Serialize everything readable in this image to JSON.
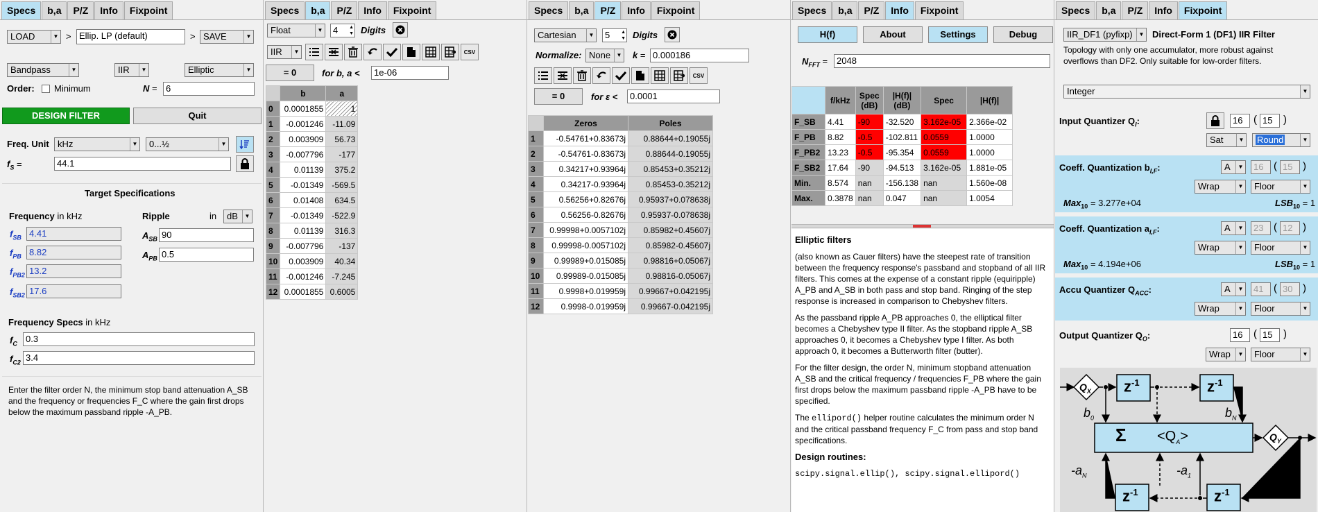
{
  "tabs": {
    "specs": "Specs",
    "ba": "b,a",
    "pz": "P/Z",
    "info": "Info",
    "fixpoint": "Fixpoint"
  },
  "panel1": {
    "load": "LOAD",
    "gt1": ">",
    "preset": "Ellip. LP (default)",
    "gt2": ">",
    "save": "SAVE",
    "response_type": "Bandpass",
    "filter_class": "IIR",
    "design_method": "Elliptic",
    "order_label": "Order:",
    "minimum_label": "Minimum",
    "n_label": "N",
    "n_eq": "=",
    "n_value": "6",
    "design_button": "DESIGN FILTER",
    "quit_button": "Quit",
    "freq_unit_label": "Freq. Unit",
    "freq_unit": "kHz",
    "freq_range": "0...½",
    "fs_label": "f",
    "fs_sub": "S",
    "fs_eq": "=",
    "fs_value": "44.1",
    "target_title": "Target Specifications",
    "frequency_label": "Frequency",
    "in_khz": "in kHz",
    "ripple_label": "Ripple",
    "in_label": "in",
    "ripple_unit": "dB",
    "freqs": [
      {
        "label": "f",
        "sub": "SB",
        "value": "4.41"
      },
      {
        "label": "f",
        "sub": "PB",
        "value": "8.82"
      },
      {
        "label": "f",
        "sub": "PB2",
        "value": "13.2"
      },
      {
        "label": "f",
        "sub": "SB2",
        "value": "17.6"
      }
    ],
    "asb_label": "A",
    "asb_sub": "SB",
    "asb_value": "90",
    "apb_label": "A",
    "apb_sub": "PB",
    "apb_value": "0.5",
    "freq_specs_title": "Frequency Specs",
    "freq_specs_unit": "in kHz",
    "fc_label": "f",
    "fc_sub": "C",
    "fc_value": "0.3",
    "fc2_label": "f",
    "fc2_sub": "C2",
    "fc2_value": "3.4",
    "help_text": "Enter the filter order N, the minimum stop band attenuation A_SB and the frequency or frequencies F_C where the gain first drops below the maximum passband ripple -A_PB."
  },
  "panel2": {
    "format": "Float",
    "digits_value": "4",
    "digits_label": "Digits",
    "filter_type": "IIR",
    "eq_zero": "= 0",
    "for_ba": "for b, a <",
    "eps_value": "1e-06",
    "columns": [
      "b",
      "a"
    ],
    "rows": [
      [
        "0",
        "0.0001855",
        "1"
      ],
      [
        "1",
        "-0.001246",
        "-11.09"
      ],
      [
        "2",
        "0.003909",
        "56.73"
      ],
      [
        "3",
        "-0.007796",
        "-177"
      ],
      [
        "4",
        "0.01139",
        "375.2"
      ],
      [
        "5",
        "-0.01349",
        "-569.5"
      ],
      [
        "6",
        "0.01408",
        "634.5"
      ],
      [
        "7",
        "-0.01349",
        "-522.9"
      ],
      [
        "8",
        "0.01139",
        "316.3"
      ],
      [
        "9",
        "-0.007796",
        "-137"
      ],
      [
        "10",
        "0.003909",
        "40.34"
      ],
      [
        "11",
        "-0.001246",
        "-7.245"
      ],
      [
        "12",
        "0.0001855",
        "0.6005"
      ]
    ]
  },
  "panel3": {
    "coord": "Cartesian",
    "digits_value": "5",
    "digits_label": "Digits",
    "normalize_label": "Normalize:",
    "normalize": "None",
    "k_label": "k",
    "k_eq": "=",
    "k_value": "0.000186",
    "eq_zero": "= 0",
    "for_eps": "for ε <",
    "eps_value": "0.0001",
    "columns": [
      "Zeros",
      "Poles"
    ],
    "rows": [
      [
        "1",
        "-0.54761+0.83673j",
        "0.88644+0.19055j"
      ],
      [
        "2",
        "-0.54761-0.83673j",
        "0.88644-0.19055j"
      ],
      [
        "3",
        "0.34217+0.93964j",
        "0.85453+0.35212j"
      ],
      [
        "4",
        "0.34217-0.93964j",
        "0.85453-0.35212j"
      ],
      [
        "5",
        "0.56256+0.82676j",
        "0.95937+0.078638j"
      ],
      [
        "6",
        "0.56256-0.82676j",
        "0.95937-0.078638j"
      ],
      [
        "7",
        "0.99998+0.0057102j",
        "0.85982+0.45607j"
      ],
      [
        "8",
        "0.99998-0.0057102j",
        "0.85982-0.45607j"
      ],
      [
        "9",
        "0.99989+0.015085j",
        "0.98816+0.05067j"
      ],
      [
        "10",
        "0.99989-0.015085j",
        "0.98816-0.05067j"
      ],
      [
        "11",
        "0.9998+0.019959j",
        "0.99667+0.042195j"
      ],
      [
        "12",
        "0.9998-0.019959j",
        "0.99667-0.042195j"
      ]
    ]
  },
  "panel4": {
    "btn_hf": "H(f)",
    "btn_about": "About",
    "btn_settings": "Settings",
    "btn_debug": "Debug",
    "nfft_label": "N",
    "nfft_sub": "FFT",
    "nfft_eq": "=",
    "nfft_value": "2048",
    "columns": [
      "f/kHz",
      "Spec (dB)",
      "|H(f)| (dB)",
      "Spec",
      "|H(f)|"
    ],
    "rows": [
      [
        "F_SB",
        "4.41",
        "-90",
        "-32.520",
        "3.162e-05",
        "2.366e-02"
      ],
      [
        "F_PB",
        "8.82",
        "-0.5",
        "-102.811",
        "0.0559",
        "1.0000"
      ],
      [
        "F_PB2",
        "13.23",
        "-0.5",
        "-95.354",
        "0.0559",
        "1.0000"
      ],
      [
        "F_SB2",
        "17.64",
        "-90",
        "-94.513",
        "3.162e-05",
        "1.881e-05"
      ],
      [
        "Min.",
        "8.574",
        "nan",
        "-156.138",
        "nan",
        "1.560e-08"
      ],
      [
        "Max.",
        "0.3878",
        "nan",
        "0.047",
        "nan",
        "1.0054"
      ]
    ],
    "info_title": "Elliptic filters",
    "para1": "(also known as Cauer filters) have the steepest rate of transition between the frequency response's passband and stopband of all IIR filters. This comes at the expense of a constant ripple (equiripple) A_PB and A_SB in both pass and stop band. Ringing of the step response is increased in comparison to Chebyshev filters.",
    "para2": "As the passband ripple A_PB approaches 0, the elliptical filter becomes a Chebyshev type II filter. As the stopband ripple A_SB approaches 0, it becomes a Chebyshev type I filter. As both approach 0, it becomes a Butterworth filter (butter).",
    "para3": "For the filter design, the order N, minimum stopband attenuation A_SB and the critical frequency / frequencies F_PB where the gain first drops below the maximum passband ripple -A_PB have to be specified.",
    "para4_code": "ellipord()",
    "para4a": "The",
    "para4b": "helper routine calculates the minimum order N and the critical passband frequency F_C from pass and stop band specifications.",
    "routines_title": "Design routines:",
    "routines_code": "scipy.signal.ellip(), scipy.signal.ellipord()"
  },
  "panel5": {
    "structure": "IIR_DF1 (pyfixp)",
    "structure_title": "Direct-Form 1 (DF1) IIR Filter",
    "structure_desc": "Topology with only one accumulator, more robust against overflows than DF2. Only suitable for low-order filters.",
    "num_format": "Integer",
    "input_q_label": "Input Quantizer Q",
    "input_q_sub": "I",
    "input_q_colon": ":",
    "input_wi": "16",
    "input_wf": "15",
    "input_ovfl": "Sat",
    "input_quant": "Round",
    "coef_b_label": "Coeff. Quantization b",
    "coef_b_sub": "I,F",
    "coef_b_colon": ":",
    "coef_b_mode": "A",
    "coef_b_wi": "16",
    "coef_b_wf": "15",
    "coef_b_ovfl": "Wrap",
    "coef_b_quant": "Floor",
    "coef_b_max_label": "Max",
    "coef_b_max_sub": "10",
    "coef_b_max": "= 3.277e+04",
    "coef_b_lsb_label": "LSB",
    "coef_b_lsb_sub": "10",
    "coef_b_lsb": "= 1",
    "coef_a_label": "Coeff. Quantization a",
    "coef_a_sub": "I,F",
    "coef_a_colon": ":",
    "coef_a_mode": "A",
    "coef_a_wi": "23",
    "coef_a_wf": "12",
    "coef_a_ovfl": "Wrap",
    "coef_a_quant": "Floor",
    "coef_a_max_label": "Max",
    "coef_a_max_sub": "10",
    "coef_a_max": "= 4.194e+06",
    "coef_a_lsb_label": "LSB",
    "coef_a_lsb_sub": "10",
    "coef_a_lsb": "= 1",
    "accu_label": "Accu Quantizer Q",
    "accu_sub": "ACC",
    "accu_colon": ":",
    "accu_mode": "A",
    "accu_wi": "41",
    "accu_wf": "30",
    "accu_ovfl": "Wrap",
    "accu_quant": "Floor",
    "out_label": "Output Quantizer Q",
    "out_sub": "O",
    "out_colon": ":",
    "out_wi": "16",
    "out_wf": "15",
    "out_ovfl": "Wrap",
    "out_quant": "Floor",
    "diagram": {
      "qx": "Q",
      "qx_sub": "X",
      "qy": "Q",
      "qy_sub": "Y",
      "z": "z",
      "zexp": "-1",
      "sigma": "Σ",
      "qa": "<Q",
      "qa_sub": "A",
      "qa_end": ">",
      "b0": "b",
      "b0_sub": "0",
      "bn": "b",
      "bn_sub": "N",
      "an": "-a",
      "an_sub": "N",
      "a1": "-a",
      "a1_sub": "1"
    }
  }
}
